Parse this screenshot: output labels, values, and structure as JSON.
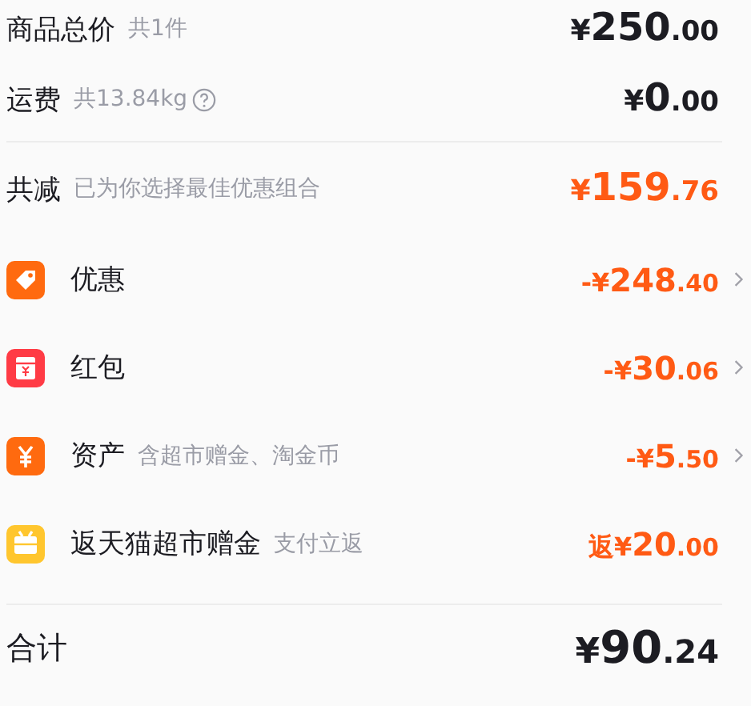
{
  "summary": [
    {
      "label": "商品总价",
      "note": "共1件",
      "help": false,
      "amount": {
        "prefix": "¥",
        "whole": "250",
        "cents": ".00"
      },
      "color": "#1c1c22"
    },
    {
      "label": "运费",
      "note": "共13.84kg",
      "help": true,
      "amount": {
        "prefix": "¥",
        "whole": "0",
        "cents": ".00"
      },
      "color": "#1c1c22"
    }
  ],
  "savings": {
    "label": "共减",
    "note": "已为你选择最佳优惠组合",
    "amount": {
      "prefix": "¥",
      "whole": "159",
      "cents": ".76"
    },
    "color": "#ff5a14"
  },
  "details": [
    {
      "kind": "discount",
      "label": "优惠",
      "amount": {
        "prefix": "-¥",
        "whole": "248",
        "cents": ".40"
      },
      "expandable": true
    },
    {
      "kind": "red-packet",
      "label": "红包",
      "amount": {
        "prefix": "-¥",
        "whole": "30",
        "cents": ".06"
      },
      "expandable": true
    },
    {
      "kind": "assets",
      "label": "资产",
      "note": "含超市赠金、淘金币",
      "amount": {
        "prefix": "-¥",
        "whole": "5",
        "cents": ".50"
      },
      "expandable": true
    },
    {
      "kind": "rebate",
      "label": "返天猫超市赠金",
      "note": "支付立返",
      "amount": {
        "prefix": "返¥",
        "whole": "20",
        "cents": ".00"
      },
      "expandable": false
    }
  ],
  "total": {
    "label": "合计",
    "amount": {
      "prefix": "¥",
      "whole": "90",
      "cents": ".24"
    }
  }
}
